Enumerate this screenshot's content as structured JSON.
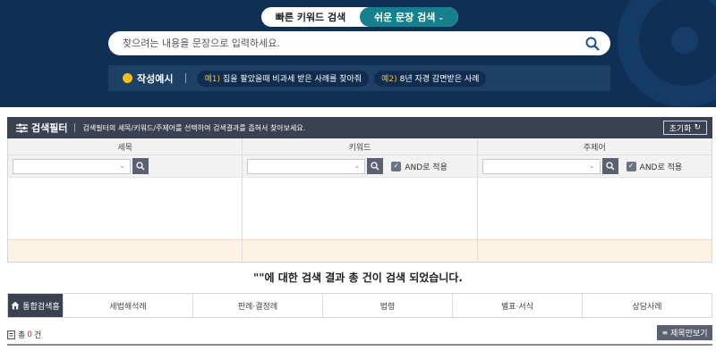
{
  "search_modes": {
    "quick_keyword": "빠른 키워드 검색",
    "easy_sentence": "쉬운 문장 검색"
  },
  "search": {
    "placeholder": "찾으려는 내용을 문장으로 입력하세요."
  },
  "examples": {
    "title": "작성예시",
    "items": [
      {
        "num": "예1)",
        "text": "집을 팔았을때 비과세 받은 사례를 찾아줘"
      },
      {
        "num": "예2)",
        "text": "8년 자경 감면받은 사례"
      }
    ]
  },
  "filter": {
    "title": "검색필터",
    "description": "검색필터의 세목/키워드/주제어를 선택하여 검색결과를 좁혀서 찾아보세요.",
    "reset_label": "초기화",
    "columns": [
      {
        "header": "세목"
      },
      {
        "header": "키워드",
        "and_label": "AND로 적용"
      },
      {
        "header": "주제어",
        "and_label": "AND로 적용"
      }
    ]
  },
  "result_message": "\"\"에 대한 검색 결과 총 건이 검색 되었습니다.",
  "tabs": [
    "통합검색홈",
    "세법해석례",
    "판례·결정례",
    "법령",
    "별표·서식",
    "상담사례"
  ],
  "total": {
    "prefix": "총",
    "count": "0",
    "suffix": "건"
  },
  "title_only_label": "제목만보기",
  "colors": {
    "banner": "#0f2f56",
    "accent_teal": "#17808e",
    "filter_bar": "#3a4150",
    "highlight_yellow": "#f5c518",
    "count_red": "#d9232d"
  }
}
